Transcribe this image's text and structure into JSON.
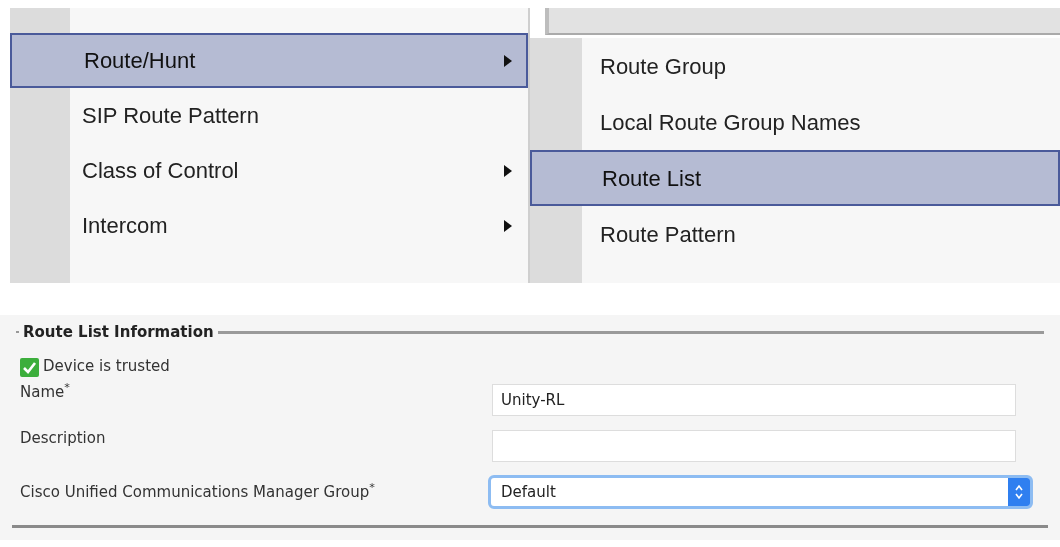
{
  "menu": {
    "items": [
      {
        "label": "Route/Hunt",
        "has_submenu": true,
        "selected": true
      },
      {
        "label": "SIP Route Pattern",
        "has_submenu": false,
        "selected": false
      },
      {
        "label": "Class of Control",
        "has_submenu": true,
        "selected": false
      },
      {
        "label": "Intercom",
        "has_submenu": true,
        "selected": false
      }
    ]
  },
  "submenu": {
    "items": [
      {
        "label": "Route Group",
        "selected": false
      },
      {
        "label": "Local Route Group Names",
        "selected": false
      },
      {
        "label": "Route List",
        "selected": true
      },
      {
        "label": "Route Pattern",
        "selected": false
      }
    ]
  },
  "form": {
    "legend": "Route List Information",
    "trusted": {
      "label": "Device is trusted",
      "checked": true
    },
    "fields": [
      {
        "kind": "text",
        "label": "Name$^{*}$",
        "value": "Unity-RL"
      },
      {
        "kind": "text",
        "label": "Description"
      },
      {
        "kind": "select",
        "label": "Cisco Unified Communications Manager Group$^{*}$",
        "value": "Default"
      }
    ]
  }
}
